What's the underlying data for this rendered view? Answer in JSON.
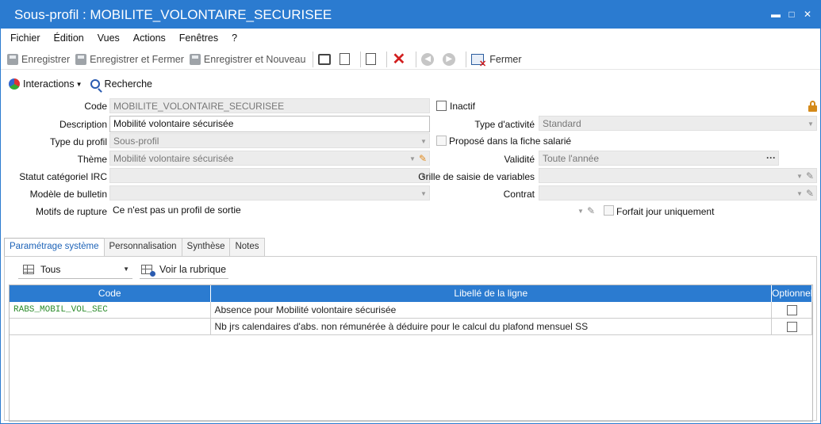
{
  "window": {
    "title": "Sous-profil : MOBILITE_VOLONTAIRE_SECURISEE"
  },
  "menu": [
    "Fichier",
    "Édition",
    "Vues",
    "Actions",
    "Fenêtres",
    "?"
  ],
  "toolbar": {
    "save": "Enregistrer",
    "save_close": "Enregistrer et Fermer",
    "save_new": "Enregistrer et Nouveau",
    "close": "Fermer"
  },
  "toolbar2": {
    "interactions": "Interactions",
    "search": "Recherche"
  },
  "form": {
    "code_label": "Code",
    "code_value": "MOBILITE_VOLONTAIRE_SECURISEE",
    "inactif_label": "Inactif",
    "description_label": "Description",
    "description_value": "Mobilité volontaire sécurisée",
    "type_activite_label": "Type d'activité",
    "type_activite_value": "Standard",
    "type_profil_label": "Type du profil",
    "type_profil_value": "Sous-profil",
    "propose_label": "Proposé dans la fiche salarié",
    "theme_label": "Thème",
    "theme_value": "Mobilité volontaire sécurisée",
    "validite_label": "Validité",
    "validite_value": "Toute l'année",
    "statut_label": "Statut catégoriel IRC",
    "statut_value": "",
    "grille_label": "Grille de saisie de variables",
    "grille_value": "",
    "modele_label": "Modèle de bulletin",
    "modele_value": "",
    "contrat_label": "Contrat",
    "contrat_value": "",
    "motifs_label": "Motifs de rupture",
    "motifs_value": "Ce n'est pas un profil de sortie",
    "forfait_label": "Forfait jour uniquement"
  },
  "tabs": [
    "Paramétrage système",
    "Personnalisation",
    "Synthèse",
    "Notes"
  ],
  "subtoolbar": {
    "filter": "Tous",
    "voir": "Voir la rubrique"
  },
  "grid": {
    "headers": [
      "Code",
      "Libellé de la ligne",
      "Optionnel"
    ],
    "rows": [
      {
        "code": "RABS_MOBIL_VOL_SEC",
        "label": "Absence pour Mobilité volontaire sécurisée"
      },
      {
        "code": "",
        "label": "Nb jrs calendaires d'abs. non rémunérée à déduire pour le calcul du plafond mensuel SS"
      }
    ]
  },
  "colors": {
    "accent": "#2b7bd0",
    "code_green": "#2c8c2c",
    "delete_red": "#d21f1f"
  }
}
